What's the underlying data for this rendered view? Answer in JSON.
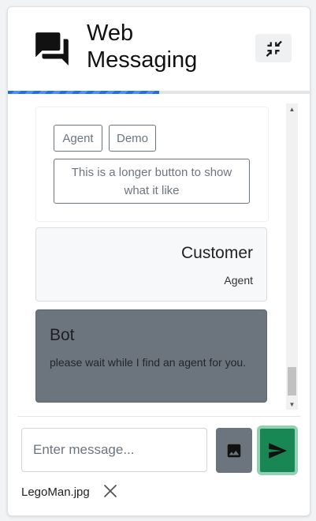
{
  "header": {
    "title_line1": "Web",
    "title_line2": "Messaging",
    "icons": {
      "chat": "forum-chat-icon",
      "minimize": "minimize-arrows-icon"
    }
  },
  "progress": {
    "percent": 50,
    "color": "#1f6fe5"
  },
  "messages": {
    "quick_replies": [
      {
        "label": "Agent"
      },
      {
        "label": "Demo"
      },
      {
        "label": "This is a longer button to show what it like"
      }
    ],
    "customer": {
      "name": "Customer",
      "text": "Agent"
    },
    "bot": {
      "name": "Bot",
      "text": "please wait while I find an agent for you."
    }
  },
  "composer": {
    "placeholder": "Enter message...",
    "value": "",
    "image_button_icon": "image-icon",
    "send_button_icon": "send-icon"
  },
  "attachment": {
    "filename": "LegoMan.jpg",
    "remove_icon": "close-icon"
  },
  "colors": {
    "send": "#198754",
    "image_button": "#6c757d",
    "bot_bubble": "#6c757d"
  }
}
